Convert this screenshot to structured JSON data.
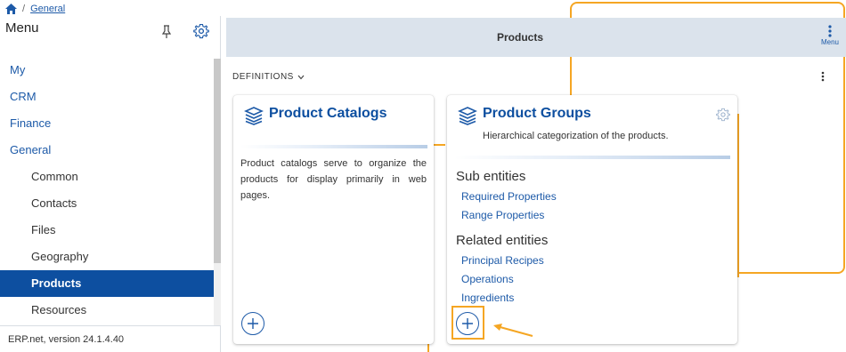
{
  "breadcrumb": {
    "home_icon": "home-icon",
    "separator": "/",
    "current": "General"
  },
  "sidebar": {
    "title": "Menu",
    "items": [
      {
        "label": "My",
        "level": 0
      },
      {
        "label": "CRM",
        "level": 0
      },
      {
        "label": "Finance",
        "level": 0
      },
      {
        "label": "General",
        "level": 0
      },
      {
        "label": "Common",
        "level": 1
      },
      {
        "label": "Contacts",
        "level": 1
      },
      {
        "label": "Files",
        "level": 1
      },
      {
        "label": "Geography",
        "level": 1
      },
      {
        "label": "Products",
        "level": 1,
        "active": true
      },
      {
        "label": "Resources",
        "level": 1
      }
    ],
    "version": "ERP.net, version 24.1.4.40"
  },
  "header": {
    "title": "Products",
    "menu_label": "Menu"
  },
  "definitions_label": "DEFINITIONS",
  "cards": {
    "catalogs": {
      "title": "Product Catalogs",
      "description": "Product catalogs serve to organize the products for display primarily in web pages."
    },
    "groups": {
      "title": "Product Groups",
      "description": "Hierarchical categorization of the products.",
      "sub_entities_heading": "Sub entities",
      "sub_entities": [
        "Required Properties",
        "Range Properties"
      ],
      "related_entities_heading": "Related entities",
      "related_entities": [
        "Principal Recipes",
        "Operations",
        "Ingredients"
      ]
    }
  },
  "colors": {
    "accent": "#0d4fa0",
    "link": "#1d5aa8",
    "highlight": "#f5a623",
    "header_bg": "#dbe3ec"
  }
}
